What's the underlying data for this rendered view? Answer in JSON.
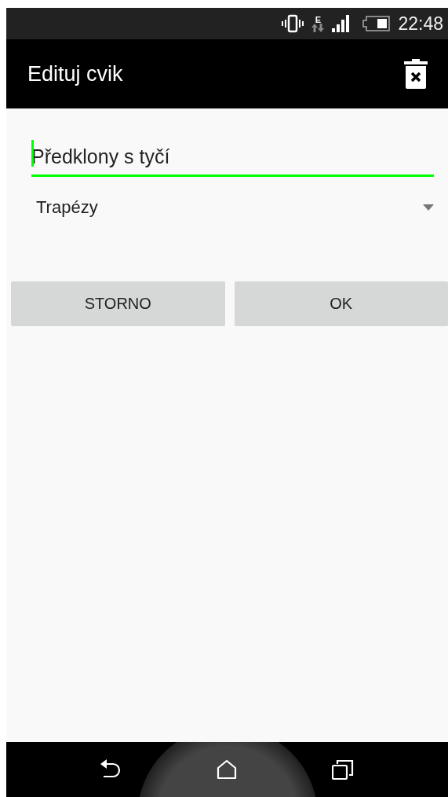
{
  "status_bar": {
    "network": "E",
    "time": "22:48"
  },
  "app_bar": {
    "title": "Edituj cvik"
  },
  "name_field": {
    "value": "Předklony s tyčí",
    "focused": true
  },
  "category_spinner": {
    "value": "Trapézy"
  },
  "buttons": [
    {
      "label": "STORNO"
    },
    {
      "label": "OK"
    }
  ]
}
